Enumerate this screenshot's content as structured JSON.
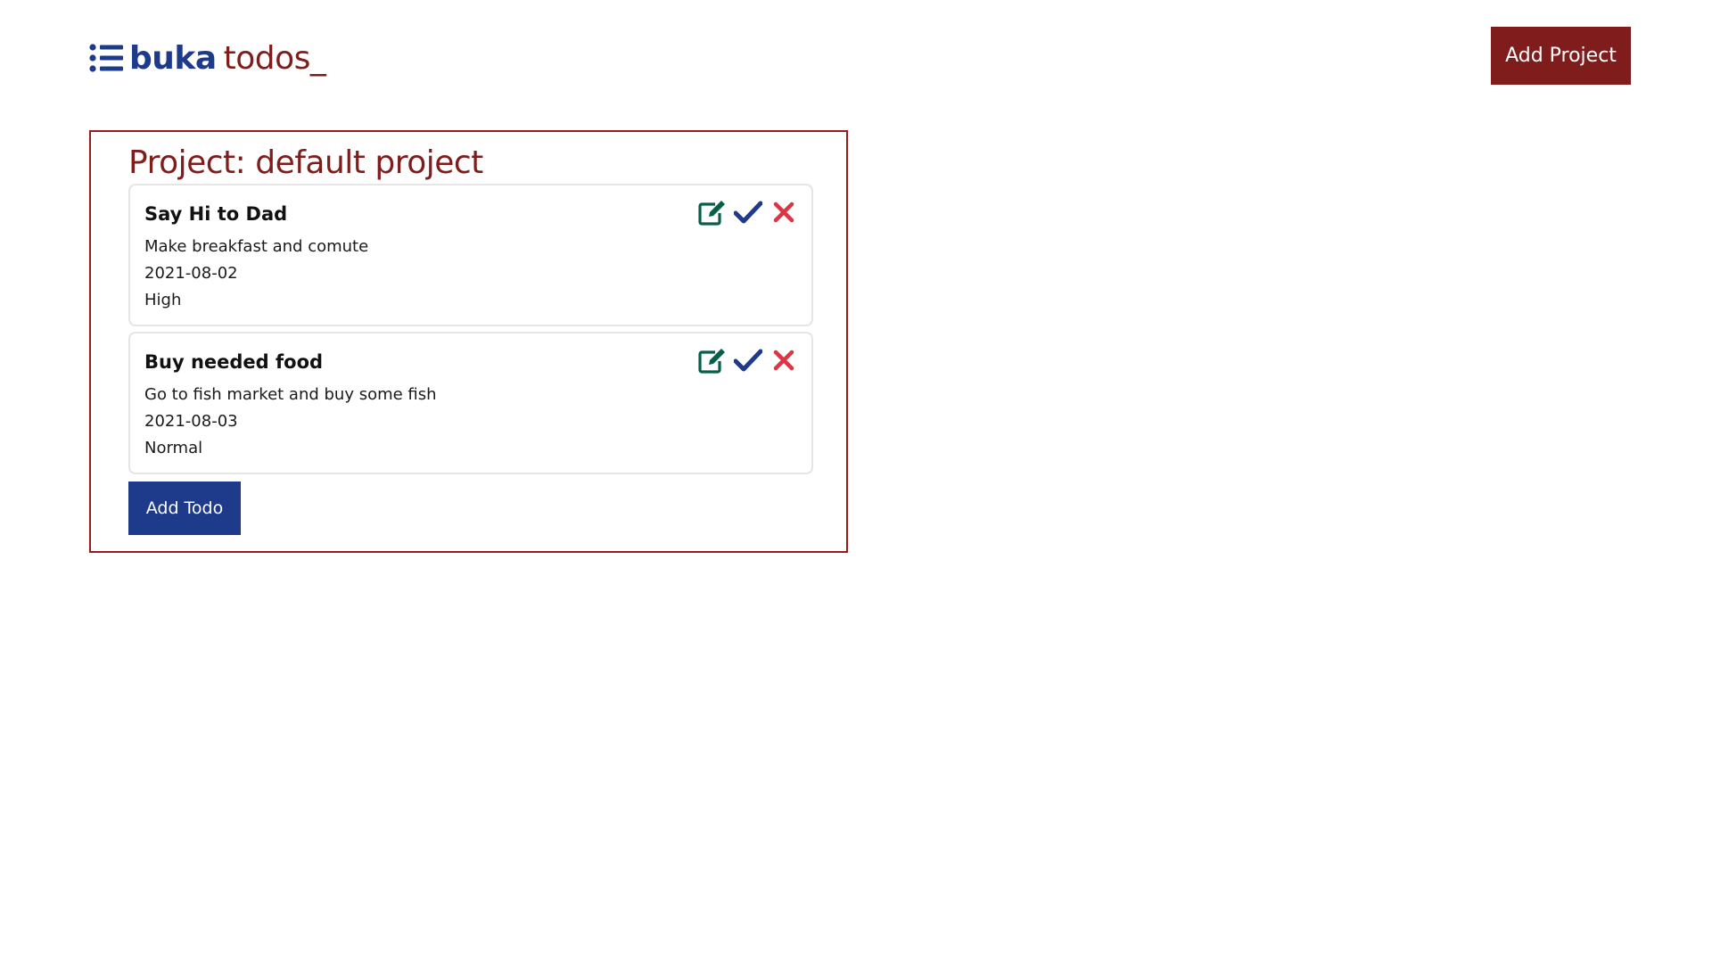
{
  "header": {
    "logo_primary": "buka",
    "logo_secondary": "todos_",
    "add_project_label": "Add Project"
  },
  "project": {
    "title": "Project: default project",
    "todos": [
      {
        "title": "Say Hi to Dad",
        "description": "Make breakfast and comute",
        "date": "2021-08-02",
        "priority": "High"
      },
      {
        "title": "Buy needed food",
        "description": "Go to fish market and buy some fish",
        "date": "2021-08-03",
        "priority": "Normal"
      }
    ],
    "add_todo_label": "Add Todo"
  },
  "icons": {
    "logo": "list-icon",
    "edit": "edit-icon",
    "complete": "check-icon",
    "delete": "close-icon"
  },
  "colors": {
    "brand_blue": "#1e3a8a",
    "brand_red": "#7f1d1d",
    "project_border": "#991b1b",
    "edit_green": "#065f46",
    "check_blue": "#1e3a8a",
    "delete_red": "#dc3545"
  }
}
